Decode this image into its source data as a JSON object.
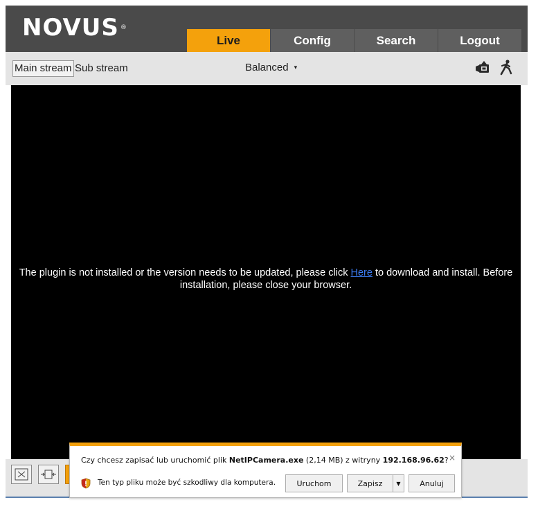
{
  "header": {
    "logo_text": "NOVUS",
    "logo_mark": "®",
    "tabs": [
      {
        "label": "Live",
        "active": true
      },
      {
        "label": "Config",
        "active": false
      },
      {
        "label": "Search",
        "active": false
      },
      {
        "label": "Logout",
        "active": false
      }
    ]
  },
  "toolbar": {
    "main_stream_label": "Main stream",
    "sub_stream_label": "Sub stream",
    "quality_label": "Balanced",
    "quality_caret": "▾",
    "icons": [
      "record-camera-icon",
      "motion-person-icon"
    ]
  },
  "video": {
    "message_before_link": "The plugin is not installed or the version needs to be updated, please click ",
    "link_text": "Here",
    "message_after_link": " to download and install. Before installation, please close your browser."
  },
  "bottombar": {
    "icons": [
      "original-size-icon",
      "fit-window-icon",
      "orange-button"
    ]
  },
  "download_bar": {
    "question_prefix": "Czy chcesz zapisać lub uruchomić plik ",
    "file_name": "NetIPCamera.exe",
    "file_size": " (2,14 MB) z witryny ",
    "site": "192.168.96.62",
    "question_suffix": "?",
    "warning_text": "Ten typ pliku może być szkodliwy dla komputera.",
    "run_label": "Uruchom",
    "save_label": "Zapisz",
    "save_arrow": "▼",
    "cancel_label": "Anuluj",
    "close_glyph": "×"
  },
  "colors": {
    "accent": "#f4a10c",
    "header_bg": "#4a4a4a",
    "tab_bg": "#5f5f5f",
    "toolbar_bg": "#e4e4e4",
    "link": "#3b7bf0"
  }
}
